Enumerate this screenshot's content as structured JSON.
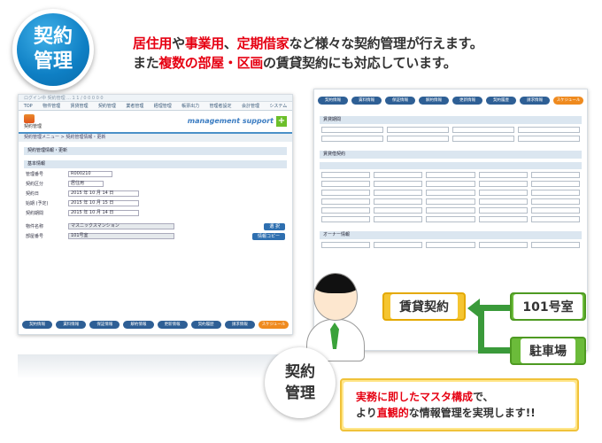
{
  "badge": {
    "line1": "契約",
    "line2": "管理"
  },
  "headline": {
    "line1": [
      {
        "text": "居住用",
        "red": true
      },
      {
        "text": "や",
        "red": false
      },
      {
        "text": "事業用",
        "red": true
      },
      {
        "text": "、",
        "red": false
      },
      {
        "text": "定期借家",
        "red": true
      },
      {
        "text": "など様々な契約管理が行えます。",
        "red": false
      }
    ],
    "line2": [
      {
        "text": "また",
        "red": false
      },
      {
        "text": "複数の部屋・区画",
        "red": true
      },
      {
        "text": "の賃貸契約にも対応しています。",
        "red": false
      }
    ]
  },
  "left_screen": {
    "topbar": "ログイン中 契約管理 ... 1 1 / 0 0 0 0 0",
    "menu": [
      "TOP",
      "物件管理",
      "賃貸管理",
      "契約管理",
      "業者管理",
      "経理管理",
      "帳票出力",
      "管理者設定",
      "会計管理",
      "システム"
    ],
    "app_title": "契約管理",
    "brand": "management support",
    "breadcrumb": "契約管理メニュー > 契約管理情報・更新",
    "section1": "契約管理情報・更新",
    "section2": "基本情報",
    "fields": [
      {
        "label": "管理番号",
        "value": "R000210"
      },
      {
        "label": "契約区分",
        "value": "居住用"
      },
      {
        "label": "契約日",
        "value": "2015 年 10 月 14 日"
      },
      {
        "label": "始期 (予定)",
        "value": "2015 年 10 月 15 日"
      },
      {
        "label": "契約期間",
        "value": "2015 年 10 月 14 日"
      },
      {
        "label": "物件名称",
        "value": "マスニックスマンション"
      },
      {
        "label": "部屋番号",
        "value": "101号室"
      }
    ],
    "select_button": "選 択",
    "copy_button": "情報コピー",
    "bottom_tabs": [
      "契約情報",
      "賃料情報",
      "保証情報",
      "解約情報",
      "更新情報",
      "契約履歴",
      "請求情報",
      "スケジュール"
    ]
  },
  "right_screen": {
    "top_tabs": [
      "契約情報",
      "賃料情報",
      "保証情報",
      "解約情報",
      "更新情報",
      "契約履歴",
      "請求情報",
      "スケジュール"
    ],
    "section1": "賃貸期間",
    "section2": "賃貸借契約",
    "section3": "オーナー情報"
  },
  "diagram": {
    "contract_label": "賃貸契約",
    "room_label": "101号室",
    "parking_label": "駐車場"
  },
  "badge2": {
    "line1": "契約",
    "line2": "管理"
  },
  "callout": {
    "line1_red": "実務に即したマスタ構成",
    "line1_rest": "で、",
    "line2_pre": "より",
    "line2_red": "直観的",
    "line2_rest": "な情報管理を実現します!!"
  }
}
